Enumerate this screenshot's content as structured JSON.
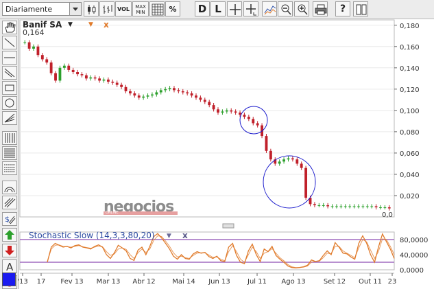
{
  "toolbar": {
    "period_label": "Diariamente",
    "buttons": [
      {
        "name": "candlestick-chart-button",
        "icon": "candlestick-icon"
      },
      {
        "name": "bar-chart-button",
        "icon": "ohlc-bars-icon"
      },
      {
        "name": "line-chart-button",
        "icon": "line-chart-icon"
      },
      {
        "name": "volume-button",
        "label": "VOL"
      },
      {
        "name": "max-min-button",
        "label": "MAX MIN"
      },
      {
        "name": "grid-button",
        "icon": "grid-icon"
      },
      {
        "name": "percent-button",
        "label": "%"
      },
      {
        "name": "daily-button",
        "label": "D"
      },
      {
        "name": "log-button",
        "label": "L"
      },
      {
        "name": "crosshair-button",
        "icon": "crosshair-icon"
      },
      {
        "name": "crosshair-label-button",
        "icon": "crosshair-label-icon"
      },
      {
        "name": "trend-button",
        "icon": "trend-icon"
      },
      {
        "name": "zoom-out-button",
        "icon": "zoom-out-icon"
      },
      {
        "name": "zoom-in-button",
        "icon": "zoom-in-icon"
      },
      {
        "name": "print-button",
        "icon": "print-icon"
      },
      {
        "name": "help-button",
        "label": "?"
      },
      {
        "name": "book-button",
        "icon": "book-icon"
      }
    ]
  },
  "sidebar": {
    "tools": [
      "hand-icon",
      "line-icon",
      "horizontal-line-icon",
      "parallel-lines-icon",
      "rectangle-icon",
      "circle-icon",
      "fan-icon",
      "fibonacci-vertical-icon",
      "fibonacci-retracement-icon",
      "arc-icon",
      "channel-icon",
      "dollar-icon",
      "arrow-up-icon",
      "arrow-down-icon",
      "text-icon",
      "delete-icon"
    ],
    "accent_color": "#1a1af0"
  },
  "legend": {
    "stock_name": "Banif SA",
    "dropdown_glyph": "▼",
    "last_value": "0,164"
  },
  "watermark": {
    "text": "negocios",
    "sub": "ONLINE"
  },
  "stochastic": {
    "label": "Stochastic Slow (14,3,3,80,20)",
    "dropdown_glyph": "▼",
    "close_glyph": "x"
  },
  "colors": {
    "up_candle": "#2ca02c",
    "down_candle": "#c0202a",
    "stoch_line": "#e07a2a",
    "stoch_bands": "#a06cc0",
    "circle": "#1a1acc"
  },
  "chart_data": [
    {
      "type": "candlestick",
      "title": "Banif SA",
      "x_tick_labels": [
        "'13",
        "17",
        "Fev 13",
        "Mar 13",
        "Abr 12",
        "Mai 14",
        "Jun 13",
        "Jul 11",
        "Ago 13",
        "Set 12",
        "Out 11",
        "23"
      ],
      "y_tick_labels": [
        "0,020",
        "0,040",
        "0,060",
        "0,080",
        "0,100",
        "0,120",
        "0,140",
        "0,160",
        "0,180"
      ],
      "ylim": [
        0.0,
        0.185
      ],
      "bottom_right_label": "0,0",
      "series": [
        {
          "name": "close",
          "values": [
            0.164,
            0.158,
            0.16,
            0.152,
            0.148,
            0.145,
            0.135,
            0.128,
            0.14,
            0.142,
            0.138,
            0.136,
            0.134,
            0.133,
            0.13,
            0.131,
            0.13,
            0.128,
            0.129,
            0.127,
            0.126,
            0.124,
            0.122,
            0.118,
            0.116,
            0.114,
            0.112,
            0.113,
            0.114,
            0.115,
            0.117,
            0.119,
            0.12,
            0.121,
            0.119,
            0.118,
            0.117,
            0.116,
            0.114,
            0.112,
            0.11,
            0.108,
            0.105,
            0.101,
            0.098,
            0.099,
            0.1,
            0.099,
            0.098,
            0.096,
            0.094,
            0.092,
            0.088,
            0.086,
            0.076,
            0.062,
            0.054,
            0.05,
            0.052,
            0.054,
            0.055,
            0.054,
            0.05,
            0.046,
            0.018,
            0.012,
            0.011,
            0.011,
            0.011,
            0.01,
            0.01,
            0.01,
            0.01,
            0.01,
            0.01,
            0.01,
            0.01,
            0.01,
            0.01,
            0.01,
            0.009,
            0.009,
            0.009,
            0.008
          ]
        }
      ]
    },
    {
      "type": "line",
      "title": "Stochastic Slow (14,3,3,80,20)",
      "y_tick_labels": [
        "0,0000",
        "40,0000",
        "80,0000"
      ],
      "ylim": [
        0,
        100
      ],
      "bands": [
        80,
        20
      ],
      "series": [
        {
          "name": "%K",
          "values": [
            20,
            60,
            70,
            65,
            60,
            62,
            58,
            64,
            66,
            60,
            58,
            55,
            62,
            66,
            60,
            40,
            30,
            45,
            65,
            58,
            50,
            30,
            25,
            52,
            60,
            40,
            62,
            88,
            96,
            84,
            70,
            55,
            36,
            28,
            40,
            30,
            28,
            42,
            48,
            44,
            46,
            35,
            30,
            36,
            24,
            22,
            60,
            70,
            38,
            20,
            16,
            50,
            68,
            40,
            22,
            55,
            48,
            62,
            38,
            28,
            20,
            10,
            6,
            5,
            6,
            8,
            12,
            26,
            22,
            24,
            38,
            50,
            40,
            72,
            60,
            44,
            42,
            34,
            28,
            70,
            90,
            70,
            40,
            20,
            60,
            95,
            75,
            55,
            30
          ]
        },
        {
          "name": "%D",
          "values": [
            22,
            55,
            65,
            66,
            62,
            61,
            60,
            62,
            64,
            61,
            59,
            57,
            60,
            63,
            61,
            48,
            38,
            42,
            55,
            58,
            54,
            40,
            30,
            45,
            55,
            46,
            55,
            78,
            90,
            88,
            76,
            62,
            45,
            34,
            36,
            32,
            30,
            38,
            44,
            45,
            45,
            39,
            33,
            34,
            28,
            24,
            48,
            64,
            48,
            28,
            20,
            40,
            60,
            48,
            30,
            44,
            48,
            56,
            44,
            32,
            24,
            14,
            8,
            6,
            6,
            7,
            10,
            20,
            22,
            23,
            32,
            44,
            42,
            62,
            62,
            50,
            44,
            38,
            32,
            58,
            80,
            74,
            52,
            30,
            48,
            82,
            80,
            62,
            40
          ]
        }
      ]
    }
  ]
}
